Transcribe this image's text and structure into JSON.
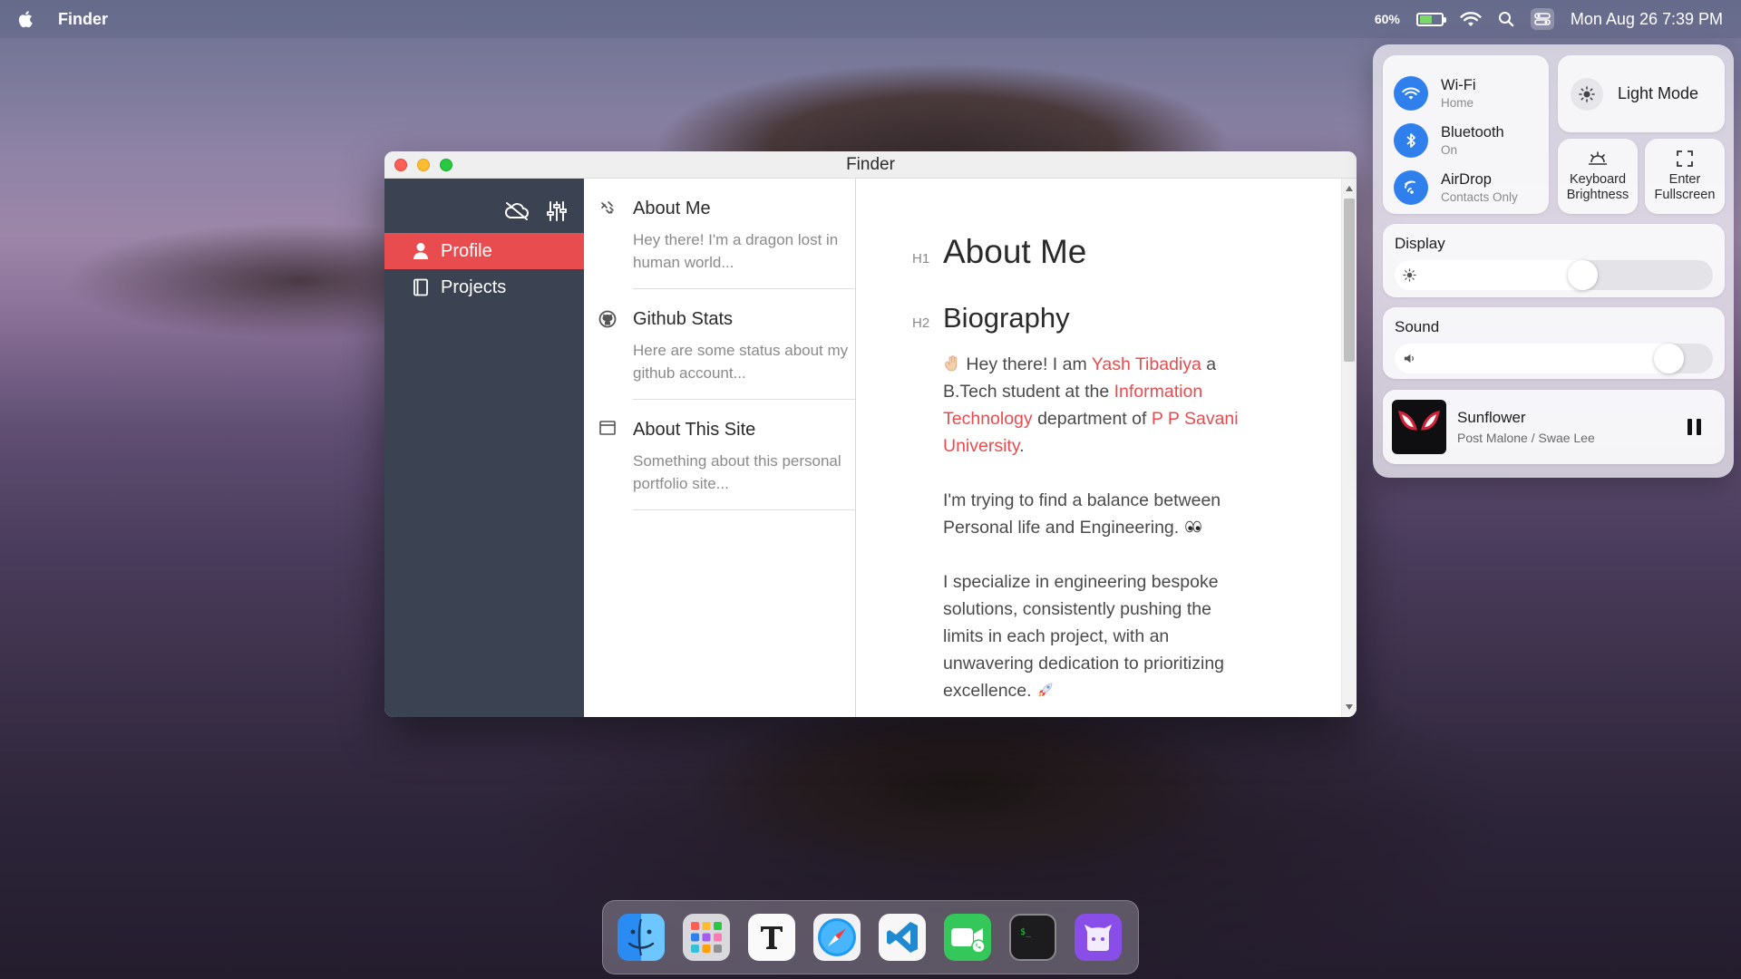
{
  "menubar": {
    "app_name": "Finder",
    "battery_percent": "60%",
    "battery_level": 0.6,
    "datetime": "Mon Aug 26 7:39 PM"
  },
  "window": {
    "title": "Finder"
  },
  "sidebar": {
    "items": [
      {
        "label": "Profile",
        "icon": "person-icon",
        "active": true
      },
      {
        "label": "Projects",
        "icon": "book-icon",
        "active": false
      }
    ]
  },
  "list": {
    "entries": [
      {
        "title": "About Me",
        "desc": "Hey there! I'm a dragon lost in human world...",
        "icon": "gesture-icon"
      },
      {
        "title": "Github Stats",
        "desc": "Here are some status about my github account...",
        "icon": "github-icon"
      },
      {
        "title": "About This Site",
        "desc": "Something about this personal portfolio site...",
        "icon": "window-icon"
      }
    ]
  },
  "content": {
    "h1_tag": "H1",
    "h1": "About Me",
    "h2_tag": "H2",
    "h2": "Biography",
    "p1": {
      "t1": "Hey there! I am ",
      "name": "Yash Tibadiya",
      "t2": " a B.Tech student at the ",
      "dept": "Information Technology",
      "t3": " department of ",
      "uni": "P P Savani University",
      "t4": "."
    },
    "p2": "I'm trying to find a balance between Personal life and Engineering.",
    "p3": "I specialize in engineering bespoke solutions, consistently pushing the limits in each project, with an unwavering dedication to prioritizing excellence."
  },
  "control_center": {
    "wifi": {
      "name": "Wi-Fi",
      "status": "Home"
    },
    "bluetooth": {
      "name": "Bluetooth",
      "status": "On"
    },
    "airdrop": {
      "name": "AirDrop",
      "status": "Contacts Only"
    },
    "light_mode": "Light Mode",
    "keyboard": "Keyboard Brightness",
    "fullscreen": "Enter Fullscreen",
    "display": {
      "label": "Display",
      "level": 0.6
    },
    "sound": {
      "label": "Sound",
      "level": 0.9
    },
    "music": {
      "song": "Sunflower",
      "artist": "Post Malone / Swae Lee"
    }
  },
  "colors": {
    "accent": "#e84c4f",
    "sidebar": "#3b4252",
    "blue": "#2f80ed"
  },
  "dock": {
    "apps": [
      "finder-icon",
      "launchpad-icon",
      "typora-icon",
      "safari-icon",
      "vscode-icon",
      "facetime-icon",
      "terminal-icon",
      "github-desktop-icon"
    ]
  }
}
